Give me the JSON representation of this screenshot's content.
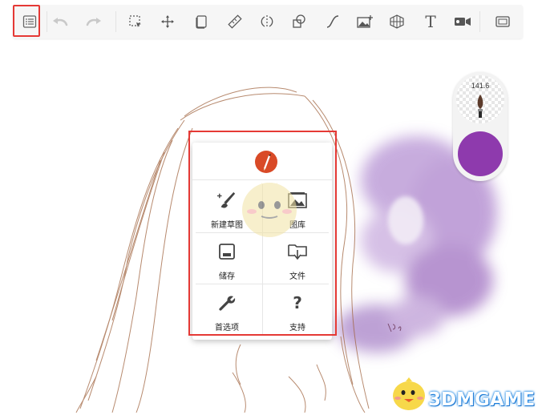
{
  "toolbar": {
    "icons": {
      "menu": "menu-list-icon",
      "undo": "undo-icon",
      "redo": "redo-icon",
      "selection": "selection-icon",
      "transform": "transform-icon",
      "layer": "layer-icon",
      "ruler": "ruler-icon",
      "symmetry": "symmetry-icon",
      "shapes": "shapes-icon",
      "curve": "curve-icon",
      "image": "add-image-icon",
      "perspective": "perspective-grid-icon",
      "text": "text-icon",
      "video": "video-record-icon",
      "fullscreen": "fullscreen-icon"
    },
    "text_tool_glyph": "T"
  },
  "brush_panel": {
    "size_value": "141.6",
    "color": "#8e3aad"
  },
  "menu": {
    "logo_color": "#d94a27",
    "items": [
      {
        "label": "新建草图",
        "icon": "new-sketch-icon"
      },
      {
        "label": "图库",
        "icon": "gallery-icon"
      },
      {
        "label": "储存",
        "icon": "save-icon"
      },
      {
        "label": "文件",
        "icon": "file-export-icon"
      },
      {
        "label": "首选项",
        "icon": "wrench-icon"
      },
      {
        "label": "支持",
        "icon": "question-icon"
      }
    ],
    "support_glyph": "?"
  },
  "watermark": {
    "text": "3DMGAME"
  },
  "colors": {
    "highlight_red": "#e53935",
    "sketch_line": "#a0643f",
    "watercolor_purple": "#9b6bc0"
  }
}
